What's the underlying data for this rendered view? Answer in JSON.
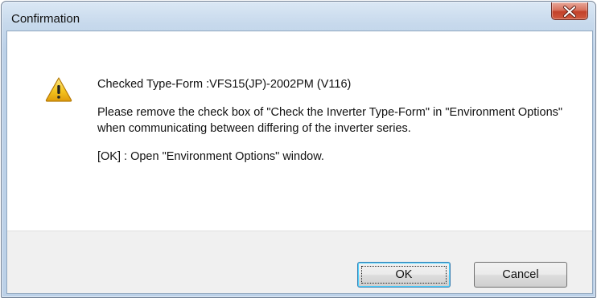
{
  "window": {
    "title": "Confirmation",
    "close_label": "X"
  },
  "message": {
    "icon": "warning-icon",
    "line1": "Checked Type-Form :VFS15(JP)-2002PM (V116)",
    "line2": "Please remove the check box of \"Check the Inverter Type-Form\" in \"Environment Options\" when communicating between differing of the inverter series.",
    "line3": "[OK] : Open \"Environment Options\" window."
  },
  "buttons": {
    "ok_label": "OK",
    "cancel_label": "Cancel"
  },
  "colors": {
    "close_button": "#c7432c",
    "warning_fill": "#f3c11b",
    "default_button_border": "#3c7fb1"
  }
}
